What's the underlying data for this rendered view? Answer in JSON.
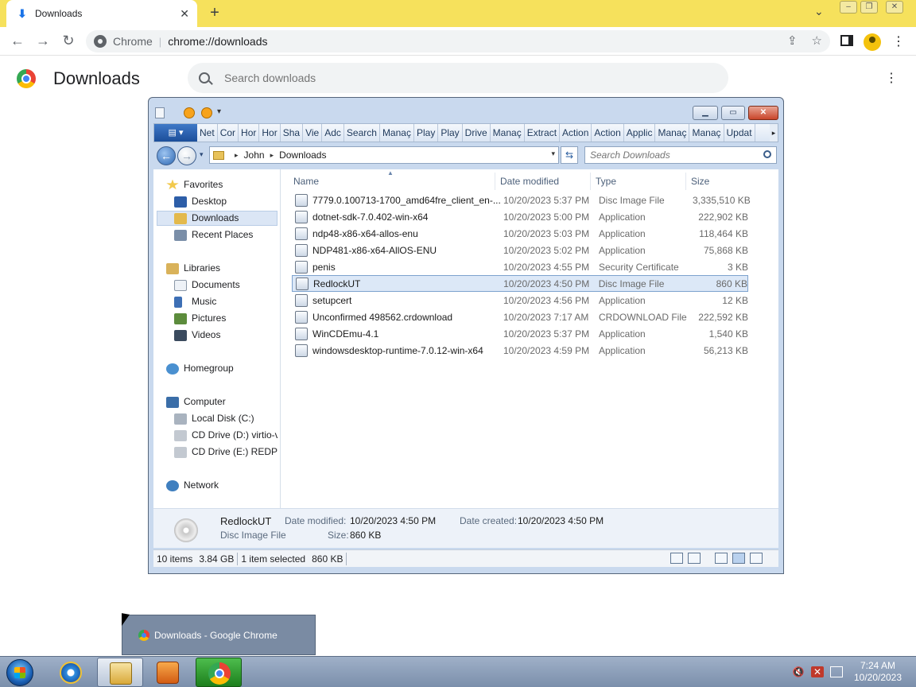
{
  "browser": {
    "tab": {
      "title": "Downloads",
      "icon": "download-icon"
    },
    "omnibox": {
      "chip": "Chrome",
      "url": "chrome://downloads"
    }
  },
  "downloads_page": {
    "title": "Downloads",
    "search_placeholder": "Search downloads"
  },
  "explorer": {
    "ribbon_app_label": "▤ ▾",
    "ribbon_tabs": [
      "Net",
      "Cor",
      "Hor",
      "Hor",
      "Sha",
      "Vie",
      "Adc",
      "Search",
      "Manaç",
      "Play",
      "Play",
      "Drive",
      "Manaç",
      "Extract",
      "Action",
      "Action",
      "Applic",
      "Manaç",
      "Manaç",
      "Updat"
    ],
    "breadcrumb": [
      "John",
      "Downloads"
    ],
    "search_placeholder": "Search Downloads",
    "nav": {
      "favorites": "Favorites",
      "desktop": "Desktop",
      "downloads": "Downloads",
      "recent_places": "Recent Places",
      "libraries": "Libraries",
      "documents": "Documents",
      "music": "Music",
      "pictures": "Pictures",
      "videos": "Videos",
      "homegroup": "Homegroup",
      "computer": "Computer",
      "local_disk": "Local Disk (C:)",
      "cd_drive_d": "CD Drive (D:) virtio-v",
      "cd_drive_e": "CD Drive (E:) REDPIL",
      "network": "Network"
    },
    "columns": {
      "name": "Name",
      "date": "Date modified",
      "type": "Type",
      "size": "Size"
    },
    "files": [
      {
        "name": "7779.0.100713-1700_amd64fre_client_en-...",
        "date": "10/20/2023 5:37 PM",
        "type": "Disc Image File",
        "size": "3,335,510 KB",
        "icon": "disc-image-icon"
      },
      {
        "name": "dotnet-sdk-7.0.402-win-x64",
        "date": "10/20/2023 5:00 PM",
        "type": "Application",
        "size": "222,902 KB",
        "icon": "installer-icon"
      },
      {
        "name": "ndp48-x86-x64-allos-enu",
        "date": "10/20/2023 5:03 PM",
        "type": "Application",
        "size": "118,464 KB",
        "icon": "installer-icon"
      },
      {
        "name": "NDP481-x86-x64-AllOS-ENU",
        "date": "10/20/2023 5:02 PM",
        "type": "Application",
        "size": "75,868 KB",
        "icon": "installer-icon"
      },
      {
        "name": "penis",
        "date": "10/20/2023 4:55 PM",
        "type": "Security Certificate",
        "size": "3 KB",
        "icon": "certificate-icon"
      },
      {
        "name": "RedlockUT",
        "date": "10/20/2023 4:50 PM",
        "type": "Disc Image File",
        "size": "860 KB",
        "icon": "disc-image-icon"
      },
      {
        "name": "setupcert",
        "date": "10/20/2023 4:56 PM",
        "type": "Application",
        "size": "12 KB",
        "icon": "application-icon"
      },
      {
        "name": "Unconfirmed 498562.crdownload",
        "date": "10/20/2023 7:17 AM",
        "type": "CRDOWNLOAD File",
        "size": "222,592 KB",
        "icon": "blank-file-icon"
      },
      {
        "name": "WinCDEmu-4.1",
        "date": "10/20/2023 5:37 PM",
        "type": "Application",
        "size": "1,540 KB",
        "icon": "wincdemu-icon"
      },
      {
        "name": "windowsdesktop-runtime-7.0.12-win-x64",
        "date": "10/20/2023 4:59 PM",
        "type": "Application",
        "size": "56,213 KB",
        "icon": "installer-icon"
      }
    ],
    "details": {
      "name": "RedlockUT",
      "type": "Disc Image File",
      "date_modified_label": "Date modified:",
      "date_modified": "10/20/2023 4:50 PM",
      "date_created_label": "Date created:",
      "date_created": "10/20/2023 4:50 PM",
      "size_label": "Size:",
      "size": "860 KB"
    },
    "status": {
      "items": "10 items",
      "total": "3.84 GB",
      "selected": "1 item selected",
      "selected_size": "860 KB"
    }
  },
  "taskbar": {
    "preview_title": "Downloads - Google Chrome",
    "clock_time": "7:24 AM",
    "clock_date": "10/20/2023"
  }
}
